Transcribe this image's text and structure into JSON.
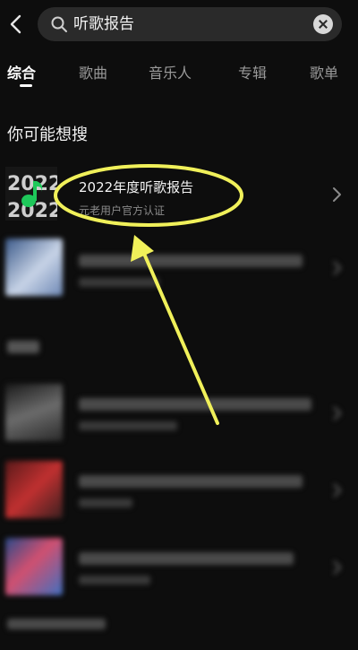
{
  "search": {
    "query": "听歌报告"
  },
  "tabs": [
    "综合",
    "歌曲",
    "音乐人",
    "专辑",
    "歌单"
  ],
  "section": {
    "title": "你可能想搜"
  },
  "highlight_result": {
    "title": "2022年度听歌报告",
    "subtitle": "元老用户官方认证",
    "cover_text": "2022"
  },
  "colors": {
    "accent_green": "#1ec85a",
    "annotation_yellow": "#f0f05a",
    "background": "#0d0d0d"
  },
  "icons": {
    "back": "chevron-left-icon",
    "search": "search-icon",
    "clear": "clear-icon",
    "more": "chevron-right-icon",
    "note": "music-note-icon"
  }
}
